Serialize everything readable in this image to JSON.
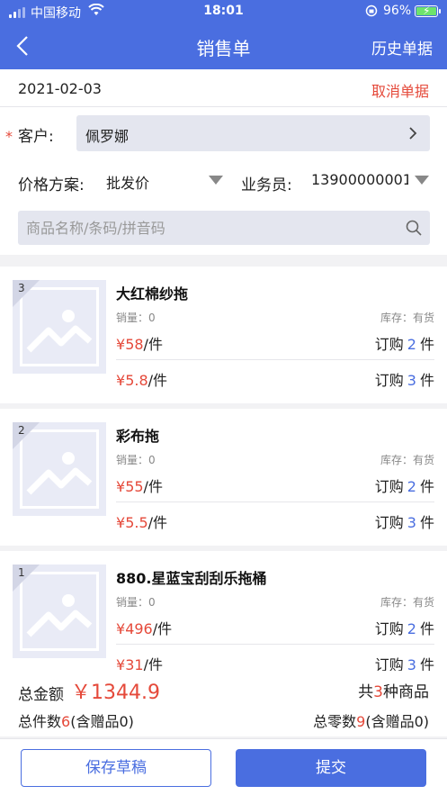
{
  "status_bar": {
    "carrier": "中国移动",
    "time": "18:01",
    "battery": "96%"
  },
  "nav": {
    "title": "销售单",
    "history": "历史单据"
  },
  "form": {
    "date": "2021-02-03",
    "cancel": "取消单据",
    "required_mark": "*",
    "customer_label": "客户:",
    "customer_value": "佩罗娜",
    "price_label": "价格方案:",
    "price_value": "批发价",
    "sales_label": "业务员:",
    "sales_value": "13900000001",
    "search_placeholder": "商品名称/条码/拼音码"
  },
  "items": [
    {
      "rank": "3",
      "name": "大红棉纱拖",
      "sales": "销量：0",
      "stock": "库存：有货",
      "rows": [
        {
          "currency": "¥",
          "price": "58",
          "unit": "/件",
          "order_prefix": "订购",
          "qty": "2",
          "order_suffix": "件"
        },
        {
          "currency": "¥",
          "price": "5.8",
          "unit": "/件",
          "order_prefix": "订购",
          "qty": "3",
          "order_suffix": "件"
        }
      ]
    },
    {
      "rank": "2",
      "name": "彩布拖",
      "sales": "销量：0",
      "stock": "库存：有货",
      "rows": [
        {
          "currency": "¥",
          "price": "55",
          "unit": "/件",
          "order_prefix": "订购",
          "qty": "2",
          "order_suffix": "件"
        },
        {
          "currency": "¥",
          "price": "5.5",
          "unit": "/件",
          "order_prefix": "订购",
          "qty": "3",
          "order_suffix": "件"
        }
      ]
    },
    {
      "rank": "1",
      "name": "880.星蓝宝刮刮乐拖桶",
      "sales": "销量：0",
      "stock": "库存：有货",
      "rows": [
        {
          "currency": "¥",
          "price": "496",
          "unit": "/件",
          "order_prefix": "订购",
          "qty": "2",
          "order_suffix": "件"
        },
        {
          "currency": "¥",
          "price": "31",
          "unit": "/件",
          "order_prefix": "订购",
          "qty": "3",
          "order_suffix": "件"
        }
      ]
    }
  ],
  "summary": {
    "total_label": "总金额",
    "total_value": "￥1344.9",
    "kinds_prefix": "共",
    "kinds_count": "3",
    "kinds_suffix": "种商品",
    "pieces_prefix": "总件数",
    "pieces_count": "6",
    "pieces_suffix": "(含赠品0)",
    "loose_prefix": "总零数",
    "loose_count": "9",
    "loose_suffix": "(含赠品0)"
  },
  "footer": {
    "draft": "保存草稿",
    "submit": "提交"
  },
  "colors": {
    "primary": "#4a6ee0",
    "accent_red": "#e5493a"
  }
}
